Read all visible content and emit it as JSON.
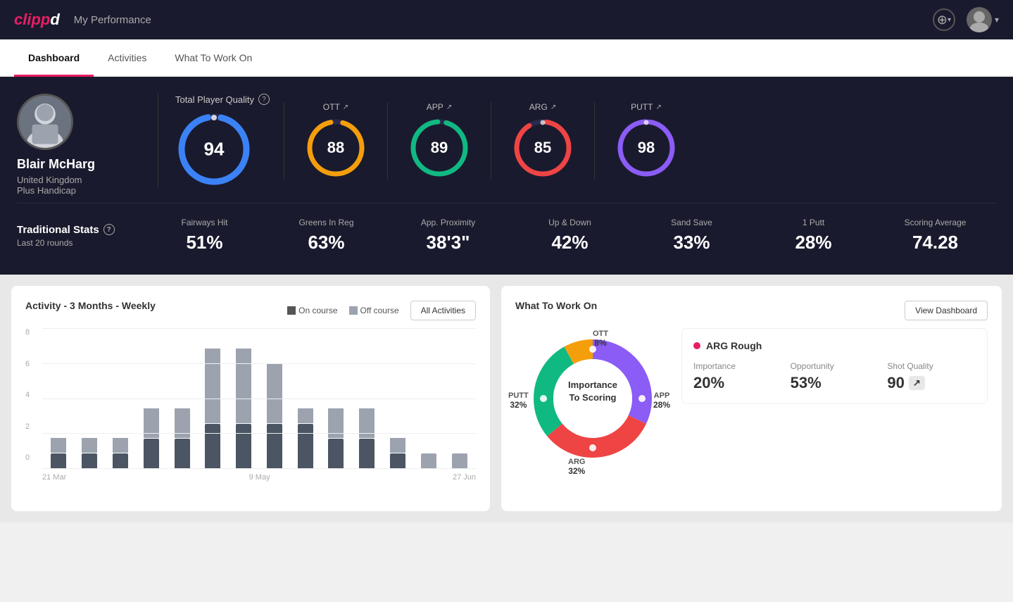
{
  "header": {
    "logo": "clippd",
    "title": "My Performance",
    "add_icon": "+",
    "caret": "▾"
  },
  "tabs": [
    {
      "label": "Dashboard",
      "active": true
    },
    {
      "label": "Activities",
      "active": false
    },
    {
      "label": "What To Work On",
      "active": false
    }
  ],
  "player": {
    "name": "Blair McHarg",
    "country": "United Kingdom",
    "handicap": "Plus Handicap"
  },
  "tpq": {
    "label": "Total Player Quality",
    "value": 94,
    "color": "#3b82f6"
  },
  "metrics": [
    {
      "label": "OTT",
      "value": 88,
      "color": "#f59e0b"
    },
    {
      "label": "APP",
      "value": 89,
      "color": "#10b981"
    },
    {
      "label": "ARG",
      "value": 85,
      "color": "#ef4444"
    },
    {
      "label": "PUTT",
      "value": 98,
      "color": "#8b5cf6"
    }
  ],
  "traditional_stats": {
    "label": "Traditional Stats",
    "sub": "Last 20 rounds",
    "items": [
      {
        "label": "Fairways Hit",
        "value": "51%"
      },
      {
        "label": "Greens In Reg",
        "value": "63%"
      },
      {
        "label": "App. Proximity",
        "value": "38'3\""
      },
      {
        "label": "Up & Down",
        "value": "42%"
      },
      {
        "label": "Sand Save",
        "value": "33%"
      },
      {
        "label": "1 Putt",
        "value": "28%"
      },
      {
        "label": "Scoring Average",
        "value": "74.28"
      }
    ]
  },
  "activity_chart": {
    "title": "Activity - 3 Months - Weekly",
    "legend_on": "On course",
    "legend_off": "Off course",
    "all_activities": "All Activities",
    "x_labels": [
      "21 Mar",
      "9 May",
      "27 Jun"
    ],
    "y_labels": [
      "0",
      "2",
      "4",
      "6",
      "8"
    ],
    "bars": [
      {
        "on": 1,
        "off": 1
      },
      {
        "on": 1,
        "off": 1
      },
      {
        "on": 1,
        "off": 1
      },
      {
        "on": 2,
        "off": 2
      },
      {
        "on": 2,
        "off": 2
      },
      {
        "on": 3,
        "off": 5
      },
      {
        "on": 3,
        "off": 5
      },
      {
        "on": 3,
        "off": 4
      },
      {
        "on": 3,
        "off": 1
      },
      {
        "on": 2,
        "off": 2
      },
      {
        "on": 2,
        "off": 2
      },
      {
        "on": 1,
        "off": 1
      },
      {
        "on": 0,
        "off": 1
      },
      {
        "on": 0,
        "off": 1
      }
    ]
  },
  "what_to_work_on": {
    "title": "What To Work On",
    "view_dashboard": "View Dashboard",
    "donut_center": "Importance\nTo Scoring",
    "segments": [
      {
        "label": "OTT",
        "pct": "8%",
        "color": "#f59e0b"
      },
      {
        "label": "APP",
        "pct": "28%",
        "color": "#10b981"
      },
      {
        "label": "ARG",
        "pct": "32%",
        "color": "#ef4444"
      },
      {
        "label": "PUTT",
        "pct": "32%",
        "color": "#8b5cf6"
      }
    ],
    "info_card": {
      "title": "ARG Rough",
      "importance_label": "Importance",
      "importance_value": "20%",
      "opportunity_label": "Opportunity",
      "opportunity_value": "53%",
      "shot_quality_label": "Shot Quality",
      "shot_quality_value": "90"
    }
  }
}
